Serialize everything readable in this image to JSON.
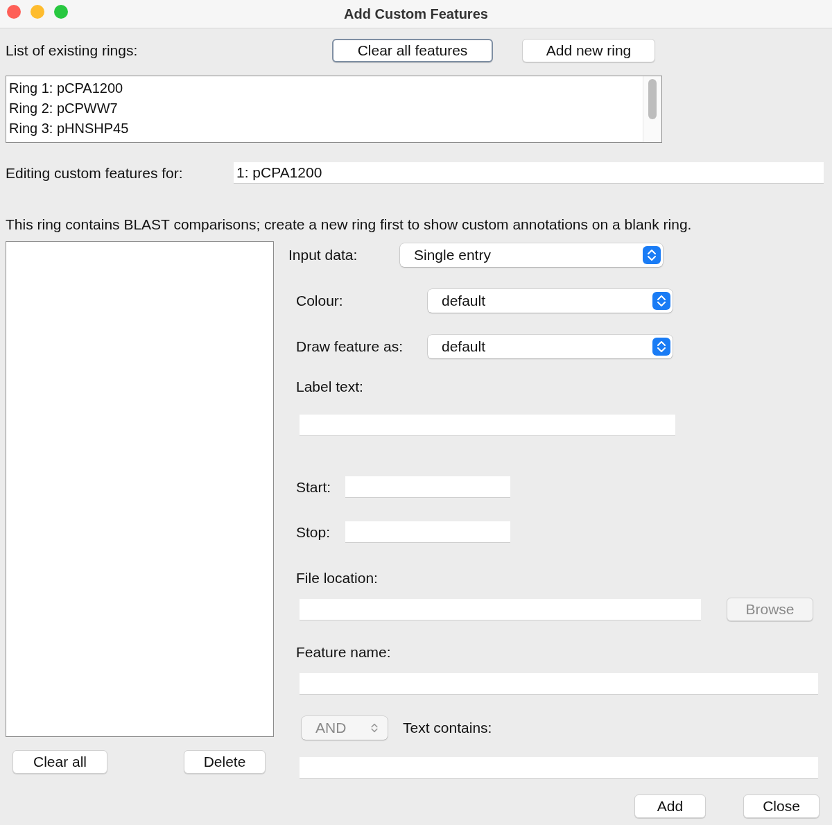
{
  "window": {
    "title": "Add Custom Features"
  },
  "rings_label": "List of existing rings:",
  "top_buttons": [
    {
      "label": "Clear all features",
      "focused": true
    },
    {
      "label": "Add new ring",
      "focused": false
    }
  ],
  "rings": [
    "Ring 1: pCPA1200",
    "Ring 2: pCPWW7",
    "Ring 3: pHNSHP45"
  ],
  "editing": {
    "label": "Editing custom features for:",
    "value": "1: pCPA1200"
  },
  "notice": "This ring contains BLAST comparisons; create a new ring first to show custom annotations on a blank ring.",
  "list_buttons": [
    "Clear all",
    "Delete"
  ],
  "form": {
    "input_data": {
      "label": "Input data:",
      "value": "Single entry"
    },
    "colour": {
      "label": "Colour:",
      "value": "default"
    },
    "draw_as": {
      "label": "Draw feature as:",
      "value": "default"
    },
    "label_text": {
      "label": "Label text:"
    },
    "start": {
      "label": "Start:"
    },
    "stop": {
      "label": "Stop:"
    },
    "file_location": {
      "label": "File location:",
      "browse": {
        "label": "Browse",
        "disabled": true
      }
    },
    "feature_name": {
      "label": "Feature name:"
    },
    "operator": {
      "value": "AND",
      "disabled": true
    },
    "text_contains": {
      "label": "Text contains:"
    }
  },
  "buttons": [
    "Add",
    "Close"
  ]
}
